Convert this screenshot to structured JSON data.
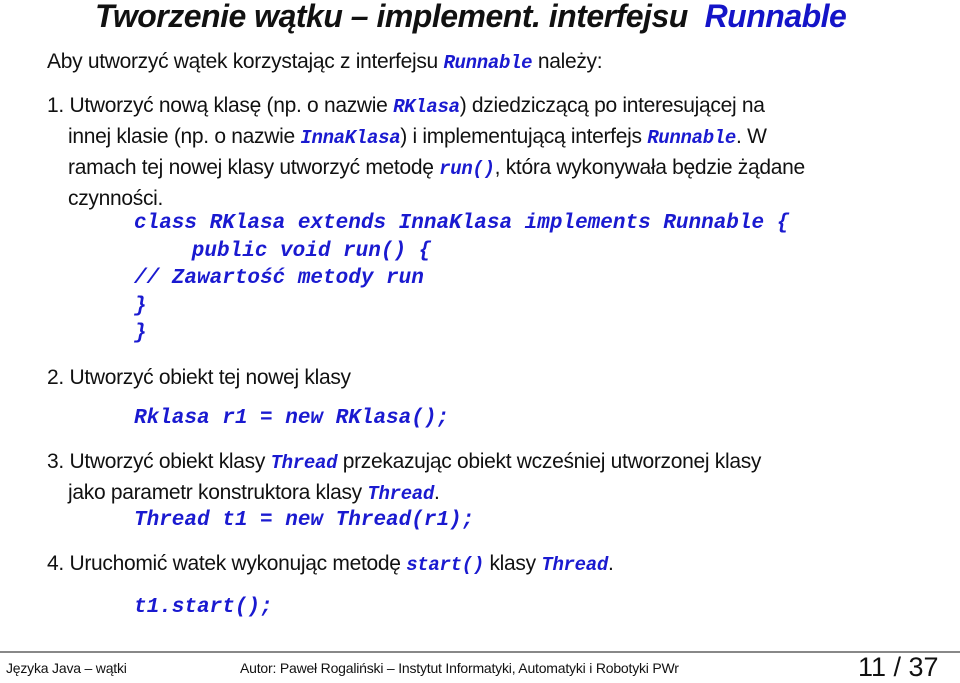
{
  "title": {
    "text": "Tworzenie wątku – implement. interfejsu",
    "code": "Runnable"
  },
  "intro": {
    "text1": "Aby utworzyć wątek korzystając z interfejsu ",
    "code": "Runnable",
    "text2": " należy:"
  },
  "step1": {
    "l1a": "1. Utworzyć nową klasę (np. o nazwie ",
    "l1code": "RKlasa",
    "l1b": ") dziedziczącą po interesującej na",
    "l2a": "innej klasie (np. o nazwie ",
    "l2code1": "InnaKlasa",
    "l2b": ") i implementującą interfejs ",
    "l2code2": "Runnable",
    "l2c": ". W",
    "l3a": "ramach tej nowej klasy utworzyć metodę ",
    "l3code": "run()",
    "l3b": ", która wykonywała będzie żądane",
    "l4": "czynności.",
    "code_lines": [
      "class RKlasa extends InnaKlasa implements Runnable {",
      "   public void run() {",
      "// Zawartość metody run",
      "}",
      "}"
    ]
  },
  "step2": {
    "text": "2. Utworzyć obiekt tej nowej klasy",
    "code": "Rklasa r1 = new RKlasa();"
  },
  "step3": {
    "l1a": "3. Utworzyć obiekt klasy ",
    "l1code": "Thread",
    "l1b": " przekazując obiekt wcześniej utworzonej klasy",
    "l2a": "jako parametr konstruktora klasy ",
    "l2code": "Thread",
    "l2b": ".",
    "code": "Thread t1 = new Thread(r1);"
  },
  "step4": {
    "a": "4. Uruchomić watek wykonując metodę ",
    "code1": "start()",
    "b": " klasy ",
    "code2": "Thread",
    "c": ".",
    "code": "t1.start();"
  },
  "footer": {
    "left": "Języka Java – wątki",
    "center": "Autor: Paweł Rogaliński – Instytut Informatyki, Automatyki i Robotyki PWr",
    "page": "11 / 37"
  }
}
